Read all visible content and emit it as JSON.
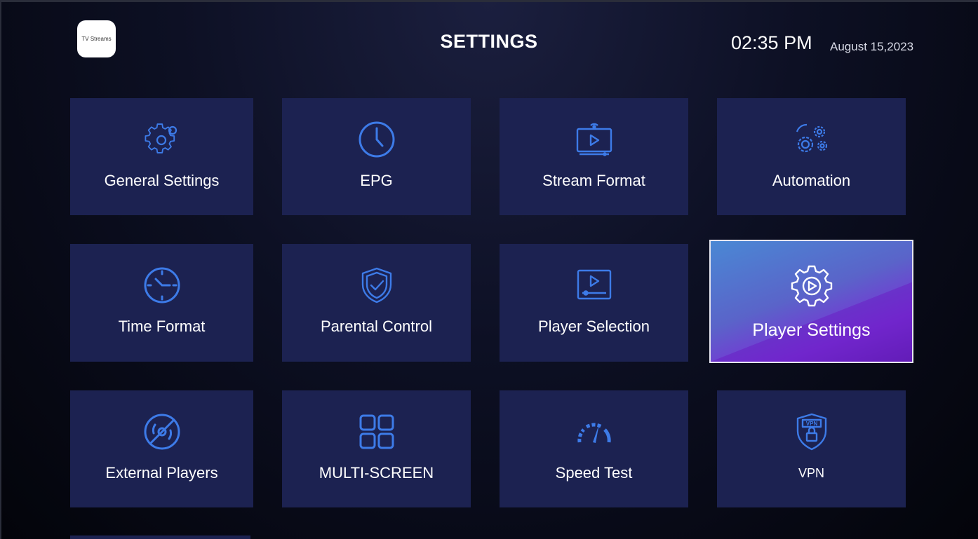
{
  "header": {
    "logo_text": "TV Streams",
    "title": "SETTINGS",
    "time": "02:35 PM",
    "date": "August 15,2023"
  },
  "tiles": [
    {
      "label": "General Settings",
      "icon": "gear-icon"
    },
    {
      "label": "EPG",
      "icon": "clock-icon"
    },
    {
      "label": "Stream Format",
      "icon": "tv-stream-icon"
    },
    {
      "label": "Automation",
      "icon": "automation-gears-icon"
    },
    {
      "label": "Time Format",
      "icon": "clock-face-icon"
    },
    {
      "label": "Parental Control",
      "icon": "shield-check-icon"
    },
    {
      "label": "Player Selection",
      "icon": "player-window-icon"
    },
    {
      "label": "Player Settings",
      "icon": "gear-play-icon",
      "selected": true
    },
    {
      "label": "External Players",
      "icon": "disc-blocked-icon"
    },
    {
      "label": "MULTI-SCREEN",
      "icon": "grid-icon"
    },
    {
      "label": "Speed Test",
      "icon": "speedometer-icon"
    },
    {
      "label": "VPN",
      "icon": "vpn-shield-icon"
    }
  ],
  "colors": {
    "tile_bg": "#1c2251",
    "icon_blue": "#3d7be8",
    "selected_gradient_start": "#4a88d4",
    "selected_gradient_end": "#7a2fd6"
  }
}
